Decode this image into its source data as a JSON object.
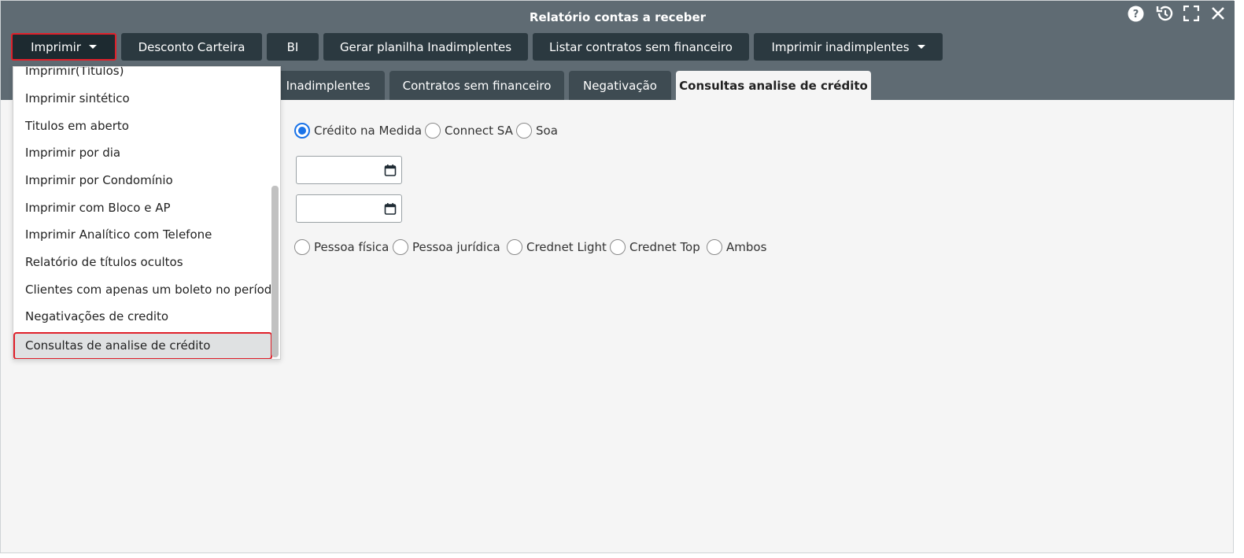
{
  "window": {
    "title": "Relatório contas a receber",
    "controls": [
      "help-icon",
      "history-icon",
      "fullscreen-icon",
      "close-icon"
    ]
  },
  "toolbar": {
    "buttons": [
      {
        "label": "Imprimir",
        "has_caret": true,
        "active": true
      },
      {
        "label": "Desconto Carteira"
      },
      {
        "label": "BI"
      },
      {
        "label": "Gerar planilha Inadimplentes"
      },
      {
        "label": "Listar contratos sem financeiro"
      },
      {
        "label": "Imprimir inadimplentes",
        "has_caret": true
      }
    ]
  },
  "tabs": [
    {
      "label": "Inadimplentes"
    },
    {
      "label": "Contratos sem financeiro"
    },
    {
      "label": "Negativação"
    },
    {
      "label": "Consultas analise de crédito",
      "active": true
    }
  ],
  "dropdown": {
    "items": [
      {
        "label": "Imprimir(Títulos)"
      },
      {
        "label": "Imprimir sintético"
      },
      {
        "label": "Titulos em aberto"
      },
      {
        "label": "Imprimir por dia"
      },
      {
        "label": "Imprimir por Condomínio"
      },
      {
        "label": "Imprimir com Bloco e AP"
      },
      {
        "label": "Imprimir Analítico com Telefone"
      },
      {
        "label": "Relatório de títulos ocultos"
      },
      {
        "label": "Clientes com apenas um boleto no período"
      },
      {
        "label": "Negativações de credito"
      },
      {
        "label": "Consultas de analise de crédito",
        "highlighted": true
      }
    ]
  },
  "form": {
    "provider_options": [
      {
        "label": "Crédito na Medida",
        "checked": true
      },
      {
        "label": "Connect SA",
        "checked": false
      },
      {
        "label": "Soa",
        "checked": false
      }
    ],
    "date_start": {
      "value": ""
    },
    "date_end": {
      "value": ""
    },
    "type_options": [
      {
        "label": "Pessoa física",
        "checked": false
      },
      {
        "label": "Pessoa jurídica",
        "checked": false
      },
      {
        "label": "Crednet Light",
        "checked": false
      },
      {
        "label": "Crednet Top",
        "checked": false
      },
      {
        "label": "Ambos",
        "checked": false
      }
    ]
  },
  "colors": {
    "header_bg": "#5f6b73",
    "button_bg": "#2b3940",
    "highlight_border": "#e0202a",
    "radio_accent": "#1a73e8"
  }
}
